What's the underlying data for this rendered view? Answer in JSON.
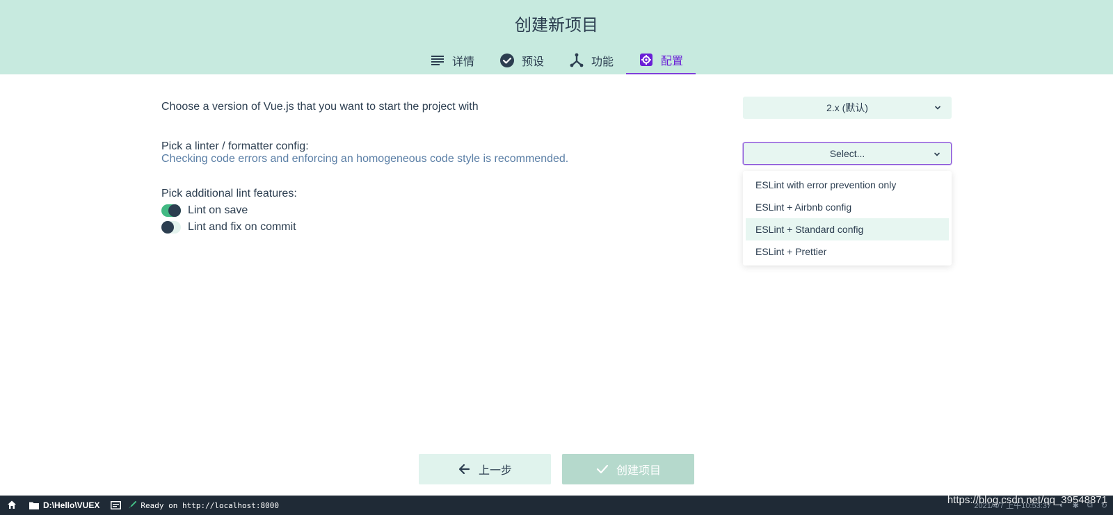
{
  "header": {
    "title": "创建新项目",
    "tabs": [
      {
        "label": "详情",
        "icon": "list-icon"
      },
      {
        "label": "预设",
        "icon": "check-circle-icon"
      },
      {
        "label": "功能",
        "icon": "fork-icon"
      },
      {
        "label": "配置",
        "icon": "gear-icon",
        "active": true
      }
    ]
  },
  "config": {
    "vue_version": {
      "label": "Choose a version of Vue.js that you want to start the project with",
      "value": "2.x (默认)"
    },
    "linter": {
      "label": "Pick a linter / formatter config:",
      "description": "Checking code errors and enforcing an homogeneous code style is recommended.",
      "value": "Select...",
      "options": [
        "ESLint with error prevention only",
        "ESLint + Airbnb config",
        "ESLint + Standard config",
        "ESLint + Prettier"
      ],
      "hovered_index": 2
    },
    "lint_features": {
      "label": "Pick additional lint features:",
      "items": [
        {
          "label": "Lint on save",
          "enabled": true
        },
        {
          "label": "Lint and fix on commit",
          "enabled": false
        }
      ]
    }
  },
  "footer": {
    "prev_label": "上一步",
    "create_label": "创建项目"
  },
  "statusbar": {
    "folder": "D:\\Hello\\VUEX",
    "log": "Ready on http://localhost:8000",
    "datetime": "2021/4/7 上午10:53:37"
  },
  "watermark": "https://blog.csdn.net/qq_39548871",
  "colors": {
    "header_bg": "#c7eadf",
    "accent": "#42b983",
    "active_tab": "#6a1fd6",
    "statusbar_bg": "#1f2a36"
  }
}
